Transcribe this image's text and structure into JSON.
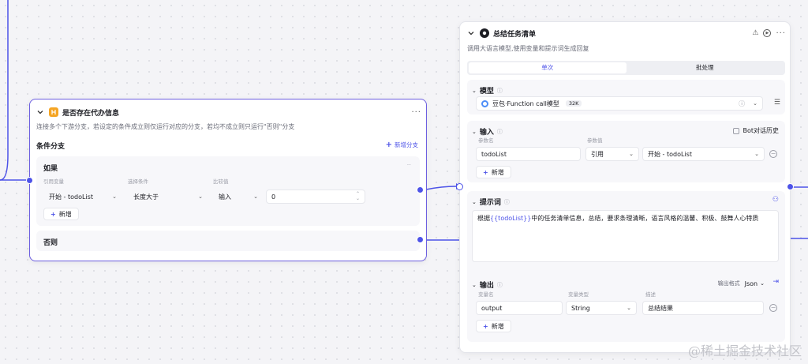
{
  "cond_node": {
    "title": "是否存在代办信息",
    "description": "连接多个下游分支，若设定的条件成立则仅运行对应的分支，若均不成立则只运行\"否则\"分支",
    "section_title": "条件分支",
    "add_branch": "新增分支",
    "if_label": "如果",
    "col_ref": "引用变量",
    "col_cond": "选择条件",
    "col_cmp": "比较值",
    "ref_value": "开始 - todoList",
    "cond_value": "长度大于",
    "cmp_type": "输入",
    "cmp_value": "0",
    "add_label": "新增",
    "else_label": "否则"
  },
  "llm_node": {
    "title": "总结任务清单",
    "description": "调用大语言模型,使用变量和提示词生成回复",
    "tabs": [
      "单次",
      "批处理"
    ],
    "model": {
      "title": "模型",
      "name": "豆包·Function call模型",
      "badge": "32K"
    },
    "input": {
      "title": "输入",
      "bot_history": "Bot对话历史",
      "col_param": "参数名",
      "col_value": "参数值",
      "param_name": "todoList",
      "ref_type": "引用",
      "ref_value": "开始 - todoList",
      "add_label": "新增"
    },
    "prompt": {
      "title": "提示词",
      "text_before": "根据",
      "text_var": "{{todoList}}",
      "text_after": "中的任务清单信息，总结，要求条理清晰，语言风格的温馨、积极、鼓舞人心特质"
    },
    "output": {
      "title": "输出",
      "format_label": "输出格式",
      "format_value": "Json",
      "col_name": "变量名",
      "col_type": "变量类型",
      "col_desc": "描述",
      "var_name": "output",
      "var_type": "String",
      "var_desc": "总结结果",
      "add_label": "新增"
    }
  },
  "watermark": "@稀土掘金技术社区",
  "colors": {
    "accent": "#4d53e8",
    "selected_border": "#6d5fe0",
    "condition_icon": "#f5a524",
    "llm_icon": "#1c1d23"
  }
}
